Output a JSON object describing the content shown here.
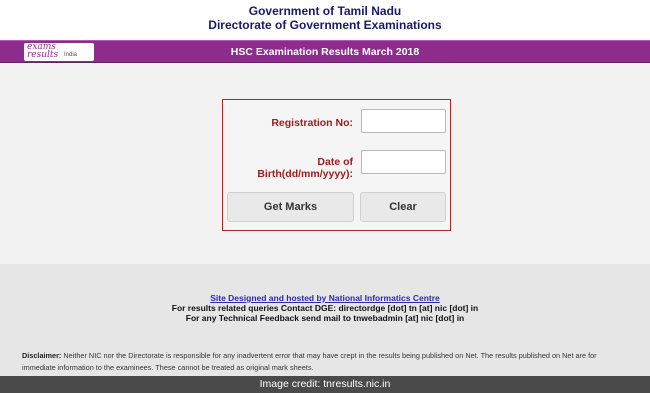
{
  "header": {
    "line1": "Government of Tamil Nadu",
    "line2": "Directorate of Government Examinations"
  },
  "banner": {
    "logo_line1": "exams",
    "logo_line2": "results",
    "logo_line3": "India",
    "title": "HSC  Examination Results  March 2018",
    "color": "#8e2c8e"
  },
  "form": {
    "registration_label": "Registration No:",
    "registration_value": "",
    "dob_label": "Date of Birth(dd/mm/yyyy):",
    "dob_value": "",
    "get_marks_label": "Get Marks",
    "clear_label": "Clear",
    "label_color": "#9b1c1c"
  },
  "footer": {
    "site_link": "Site Designed and hosted by National Informatics Centre",
    "contact_line": "For results related queries Contact DGE:  directordge [dot] tn [at] nic [dot] in",
    "feedback_line": "For any Technical Feedback send mail to tnwebadmin [at] nic [dot] in",
    "disclaimer_label": "Disclaimer:",
    "disclaimer_text": " Neither NIC nor the Directorate is responsible for any inadvertent error that may have crept in the results being published on Net. The results published on Net are for immediate information to the examinees. These cannot be treated as original mark sheets."
  },
  "credit": "Image credit: tnresults.nic.in"
}
